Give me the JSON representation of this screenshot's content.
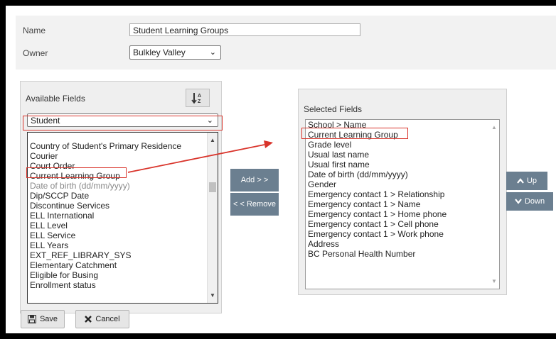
{
  "form": {
    "name_label": "Name",
    "name_value": "Student Learning Groups",
    "owner_label": "Owner",
    "owner_value": "Bulkley Valley"
  },
  "available": {
    "title": "Available Fields",
    "table_select": "Student",
    "items": [
      "Country of Student's Primary Residence",
      "Courier",
      "Court Order",
      "Current Learning Group",
      "Date of birth (dd/mm/yyyy)",
      "Dip/SCCP Date",
      "Discontinue Services",
      "ELL International",
      "ELL Level",
      "ELL Service",
      "ELL Years",
      "EXT_REF_LIBRARY_SYS",
      "Elementary Catchment",
      "Eligible for Busing",
      "Enrollment status"
    ]
  },
  "selected": {
    "title": "Selected Fields",
    "items": [
      "School > Name",
      "Current Learning Group",
      "Grade level",
      "Usual last name",
      "Usual first name",
      "Date of birth (dd/mm/yyyy)",
      "Gender",
      "Emergency contact 1 > Relationship",
      "Emergency contact 1 > Name",
      "Emergency contact 1 > Home phone",
      "Emergency contact 1 > Cell phone",
      "Emergency contact 1 > Work phone",
      "Address",
      "BC Personal Health Number"
    ]
  },
  "buttons": {
    "add": "Add > >",
    "remove": "< < Remove",
    "up": "Up",
    "down": "Down",
    "save": "Save",
    "cancel": "Cancel"
  },
  "colors": {
    "highlight": "#d9342b",
    "button": "#6b7f90"
  }
}
